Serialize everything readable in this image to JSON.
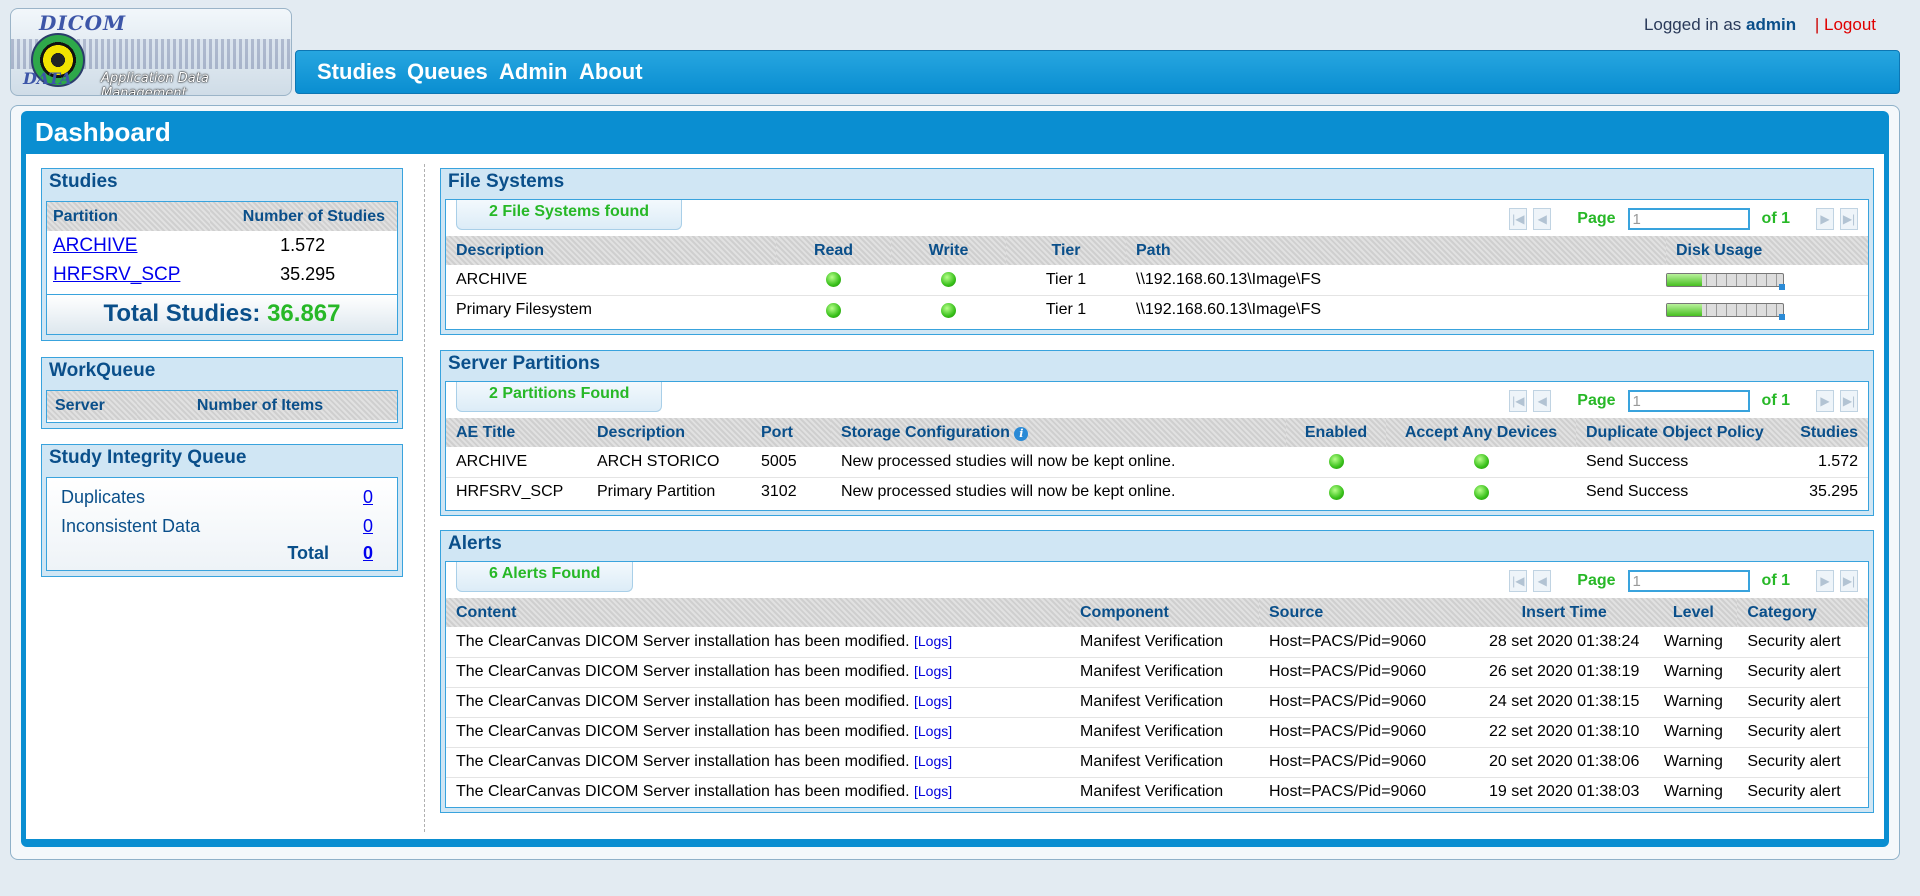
{
  "header": {
    "logo_text_top": "DICOM",
    "logo_text_bottom": "DATA",
    "logo_subtitle": "Application Data Management",
    "nav": [
      "Studies",
      "Queues",
      "Admin",
      "About"
    ],
    "login_prefix": "Logged in as",
    "login_user": "admin",
    "separator": "|",
    "logout": "Logout"
  },
  "dashboard": {
    "title": "Dashboard"
  },
  "studies": {
    "title": "Studies",
    "col_partition": "Partition",
    "col_number": "Number of Studies",
    "rows": [
      {
        "partition": "ARCHIVE",
        "count": "1.572"
      },
      {
        "partition": "HRFSRV_SCP",
        "count": "35.295"
      }
    ],
    "total_label": "Total Studies:",
    "total_value": "36.867"
  },
  "workqueue": {
    "title": "WorkQueue",
    "col_server": "Server",
    "col_items": "Number of Items"
  },
  "integrity": {
    "title": "Study Integrity Queue",
    "duplicates_label": "Duplicates",
    "duplicates_value": "0",
    "inconsistent_label": "Inconsistent Data",
    "inconsistent_value": "0",
    "total_label": "Total",
    "total_value": "0"
  },
  "pager": {
    "page_label": "Page",
    "page_value": "1",
    "of_label": "of 1"
  },
  "filesystems": {
    "title": "File Systems",
    "found": "2 File Systems found",
    "columns": [
      "Description",
      "Read",
      "Write",
      "Tier",
      "Path",
      "Disk Usage"
    ],
    "rows": [
      {
        "description": "ARCHIVE",
        "read": true,
        "write": true,
        "tier": "Tier 1",
        "path": "\\\\192.168.60.13\\Image\\FS",
        "usage": 0.3
      },
      {
        "description": "Primary Filesystem",
        "read": true,
        "write": true,
        "tier": "Tier 1",
        "path": "\\\\192.168.60.13\\Image\\FS",
        "usage": 0.3
      }
    ]
  },
  "partitions": {
    "title": "Server Partitions",
    "found": "2 Partitions Found",
    "columns": [
      "AE Title",
      "Description",
      "Port",
      "Storage Configuration",
      "Enabled",
      "Accept Any Devices",
      "Duplicate Object Policy",
      "Studies"
    ],
    "rows": [
      {
        "ae": "ARCHIVE",
        "description": "ARCH STORICO",
        "port": "5005",
        "storage": "New processed studies will now be kept online.",
        "policy": "Send Success",
        "studies": "1.572"
      },
      {
        "ae": "HRFSRV_SCP",
        "description": "Primary Partition",
        "port": "3102",
        "storage": "New processed studies will now be kept online.",
        "policy": "Send Success",
        "studies": "35.295"
      }
    ]
  },
  "alerts": {
    "title": "Alerts",
    "found": "6 Alerts Found",
    "columns": [
      "Content",
      "Component",
      "Source",
      "Insert Time",
      "Level",
      "Category"
    ],
    "logs_label": "[Logs]",
    "rows": [
      {
        "content": "The ClearCanvas DICOM Server installation has been modified.",
        "component": "Manifest Verification",
        "source": "Host=PACS/Pid=9060",
        "time": "28 set 2020 01:38:24",
        "level": "Warning",
        "category": "Security alert"
      },
      {
        "content": "The ClearCanvas DICOM Server installation has been modified.",
        "component": "Manifest Verification",
        "source": "Host=PACS/Pid=9060",
        "time": "26 set 2020 01:38:19",
        "level": "Warning",
        "category": "Security alert"
      },
      {
        "content": "The ClearCanvas DICOM Server installation has been modified.",
        "component": "Manifest Verification",
        "source": "Host=PACS/Pid=9060",
        "time": "24 set 2020 01:38:15",
        "level": "Warning",
        "category": "Security alert"
      },
      {
        "content": "The ClearCanvas DICOM Server installation has been modified.",
        "component": "Manifest Verification",
        "source": "Host=PACS/Pid=9060",
        "time": "22 set 2020 01:38:10",
        "level": "Warning",
        "category": "Security alert"
      },
      {
        "content": "The ClearCanvas DICOM Server installation has been modified.",
        "component": "Manifest Verification",
        "source": "Host=PACS/Pid=9060",
        "time": "20 set 2020 01:38:06",
        "level": "Warning",
        "category": "Security alert"
      },
      {
        "content": "The ClearCanvas DICOM Server installation has been modified.",
        "component": "Manifest Verification",
        "source": "Host=PACS/Pid=9060",
        "time": "19 set 2020 01:38:03",
        "level": "Warning",
        "category": "Security alert"
      }
    ]
  }
}
